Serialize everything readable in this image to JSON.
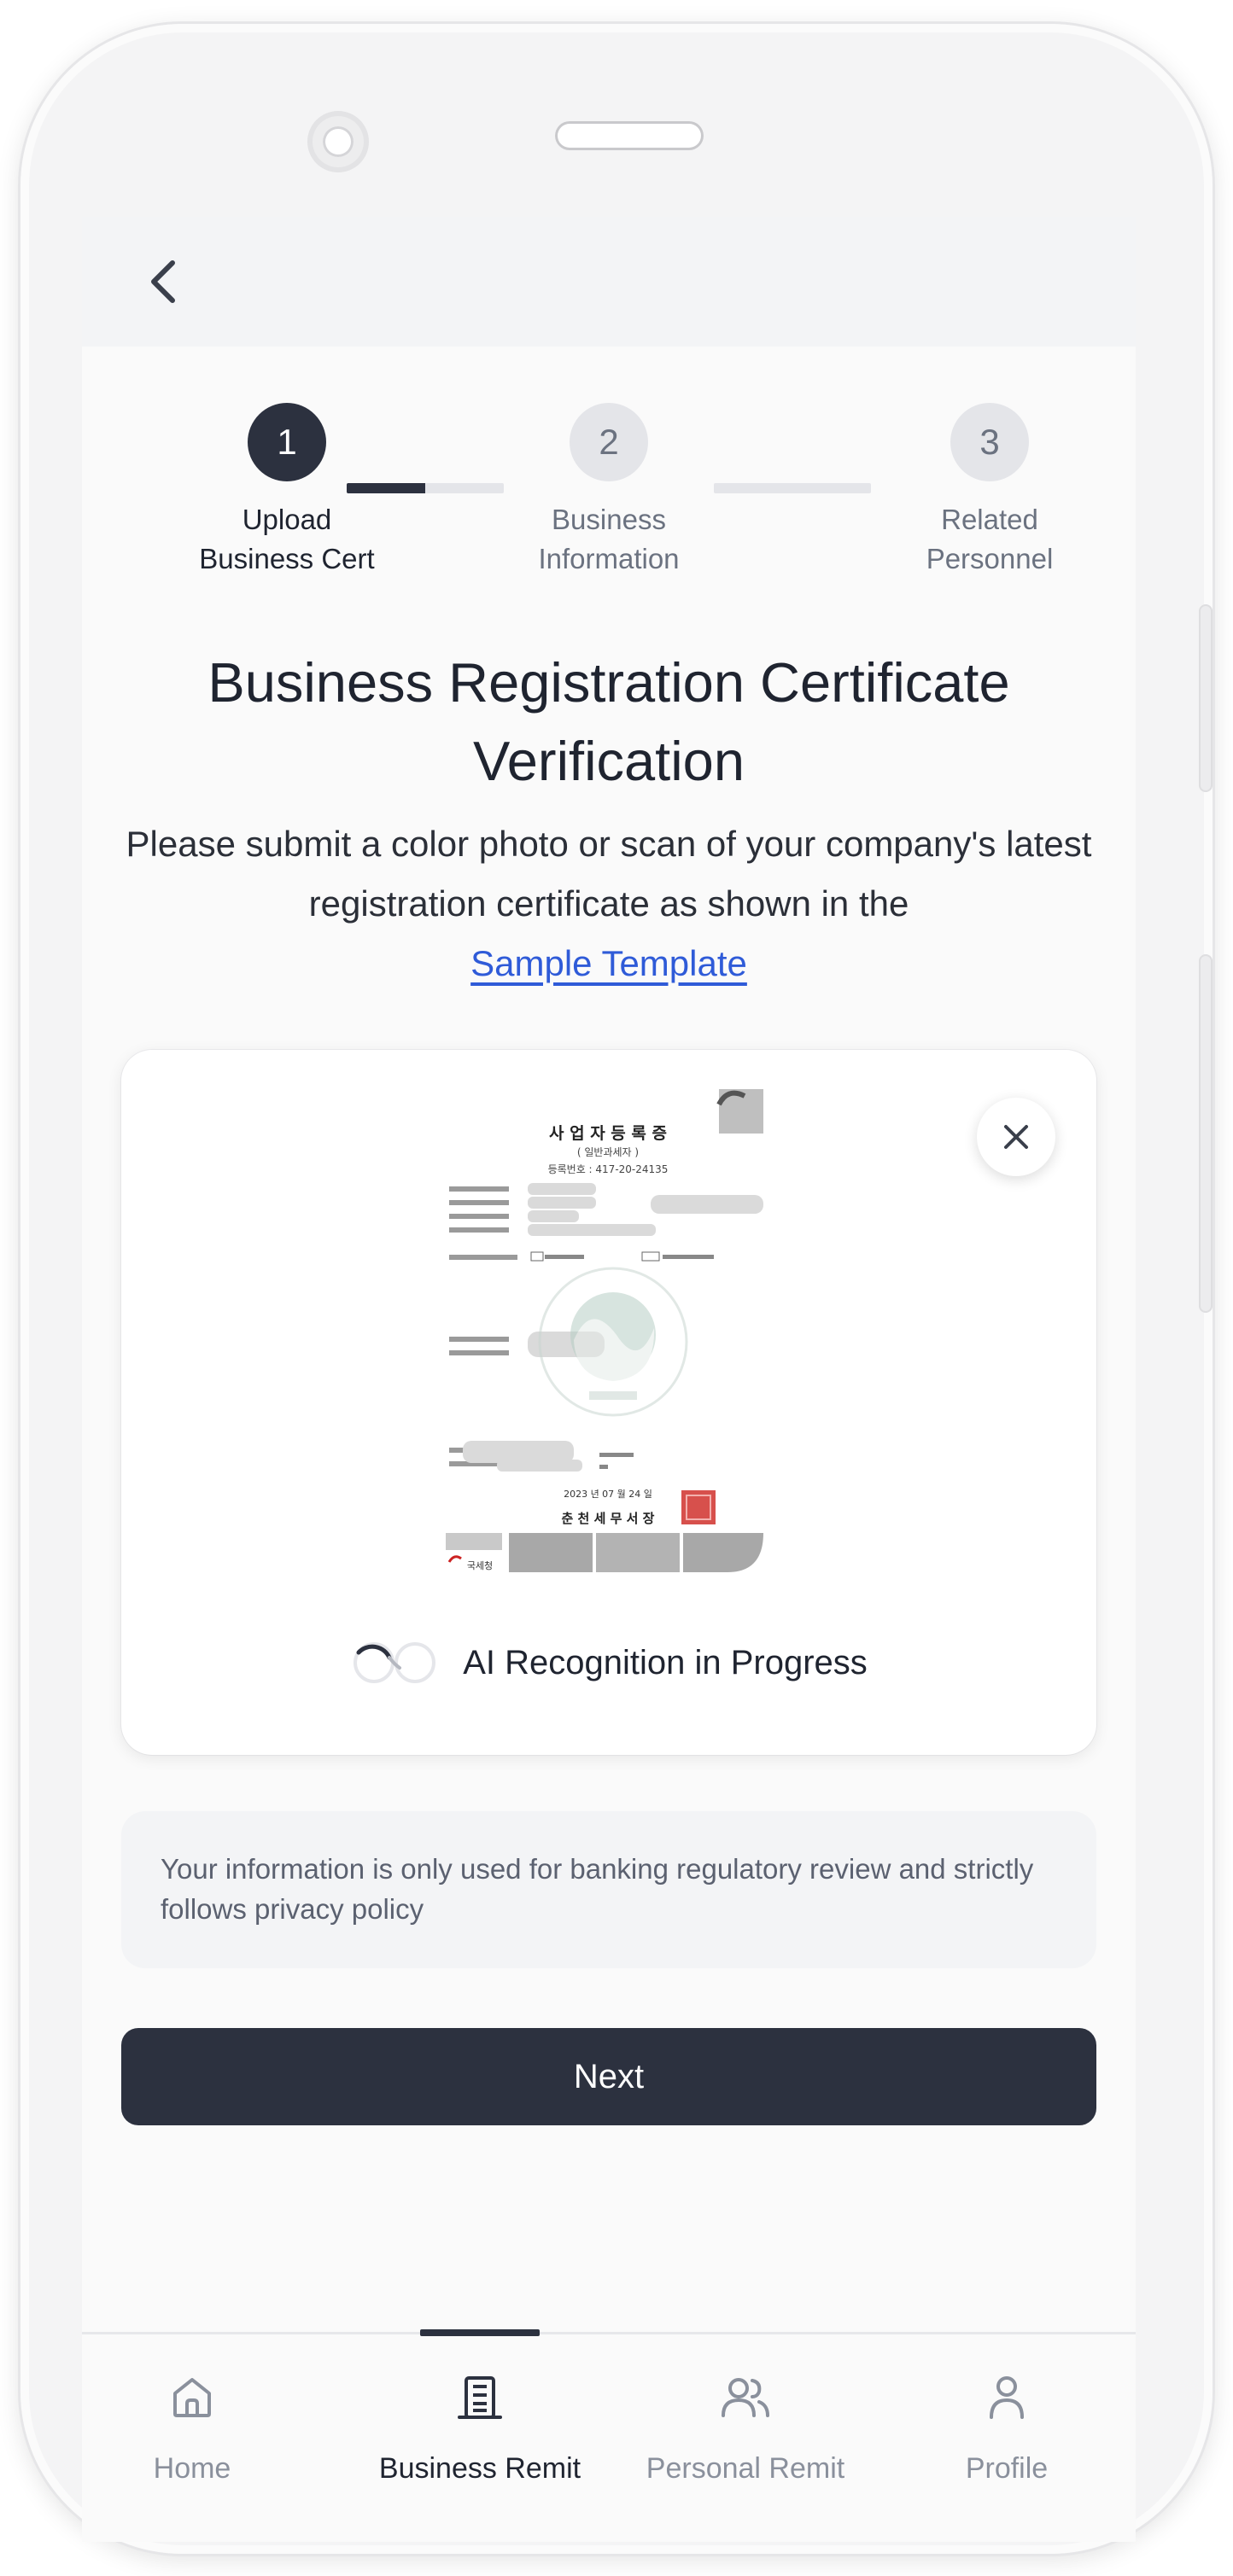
{
  "header": {
    "back_icon": "chevron-left-icon"
  },
  "stepper": {
    "steps": [
      {
        "number": "1",
        "line1": "Upload",
        "line2": "Business Cert",
        "state": "active"
      },
      {
        "number": "2",
        "line1": "Business",
        "line2": "Information",
        "state": "inactive"
      },
      {
        "number": "3",
        "line1": "Related",
        "line2": "Personnel",
        "state": "inactive"
      }
    ],
    "progress": [
      0.5,
      0
    ]
  },
  "title_line1": "Business Registration Certificate",
  "title_line2": "Verification",
  "description": {
    "text": "Please submit a color photo or scan of your company's latest registration certificate as shown in the",
    "link": "Sample Template"
  },
  "upload": {
    "close_icon": "close-icon",
    "status_text": "AI Recognition in Progress",
    "status_icon": "spinner-icon",
    "certificate": {
      "heading": "사 업 자 등 록 증",
      "subheading": "( 일반과세자 )",
      "reg_no": "등록번호 : 417-20-24135",
      "date": "2023 년 07 월 24 일",
      "office": "춘 천 세 무 서 장",
      "footer_label": "국세청"
    }
  },
  "notice": "Your information is only used for banking regulatory review and strictly follows privacy policy",
  "next_button": "Next",
  "nav": {
    "items": [
      {
        "label": "Home",
        "icon": "home-icon",
        "active": false
      },
      {
        "label": "Business Remit",
        "icon": "building-icon",
        "active": true
      },
      {
        "label": "Personal Remit",
        "icon": "users-icon",
        "active": false
      },
      {
        "label": "Profile",
        "icon": "user-icon",
        "active": false
      }
    ]
  },
  "colors": {
    "primary": "#2c313f",
    "link": "#2f5bd8",
    "muted": "#6b7280",
    "stamp": "#d0312d"
  }
}
